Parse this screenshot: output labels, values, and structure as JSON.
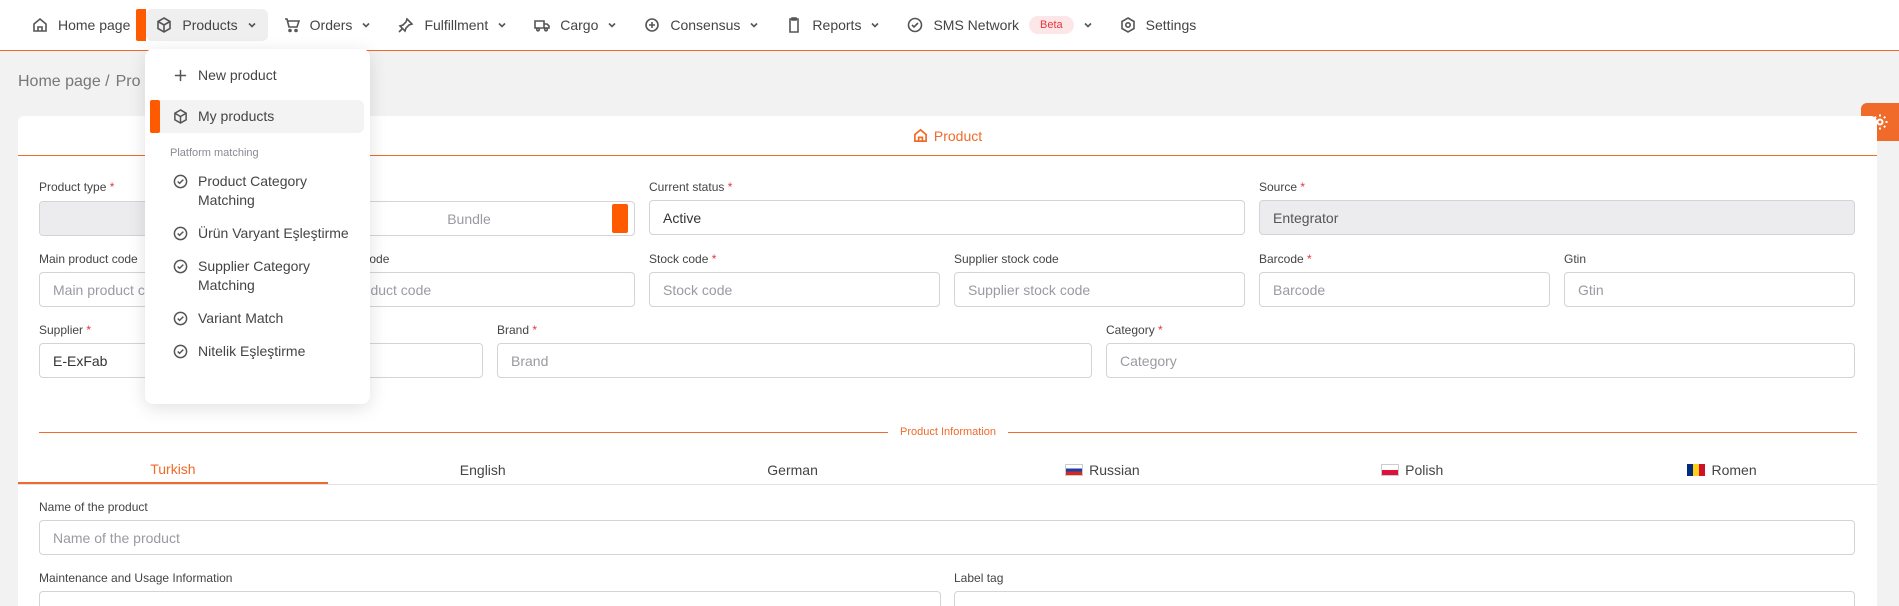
{
  "nav": {
    "items": [
      {
        "label": "Home page",
        "icon": "home-icon"
      },
      {
        "label": "Products",
        "icon": "box-icon"
      },
      {
        "label": "Orders",
        "icon": "cart-icon"
      },
      {
        "label": "Fulfillment",
        "icon": "pin-icon"
      },
      {
        "label": "Cargo",
        "icon": "truck-icon"
      },
      {
        "label": "Consensus",
        "icon": "handshake-icon"
      },
      {
        "label": "Reports",
        "icon": "clipboard-icon"
      },
      {
        "label": "SMS Network",
        "icon": "check-circle-icon",
        "badge": "Beta"
      },
      {
        "label": "Settings",
        "icon": "gear-icon"
      }
    ]
  },
  "breadcrumb": {
    "home": "Home page /",
    "current": "Pro"
  },
  "card": {
    "tab_label": "Product"
  },
  "form": {
    "product_type": {
      "label": "Product type",
      "options": [
        "",
        "Bundle"
      ]
    },
    "current_status": {
      "label": "Current status",
      "value": "Active"
    },
    "source": {
      "label": "Source",
      "value": "Entegrator"
    },
    "main_product_code": {
      "label": "Main product code",
      "placeholder": "Main product c"
    },
    "product_code": {
      "label": "uct code",
      "placeholder": "roduct code"
    },
    "stock_code": {
      "label": "Stock code",
      "placeholder": "Stock code"
    },
    "supplier_stock_code": {
      "label": "Supplier stock code",
      "placeholder": "Supplier stock code"
    },
    "barcode": {
      "label": "Barcode",
      "placeholder": "Barcode"
    },
    "gtin": {
      "label": "Gtin",
      "placeholder": "Gtin"
    },
    "supplier": {
      "label": "Supplier",
      "value": "E-ExFab"
    },
    "brand": {
      "label": "Brand",
      "placeholder": "Brand"
    },
    "category": {
      "label": "Category",
      "placeholder": "Category"
    },
    "required_mark": "*"
  },
  "product_info": {
    "section_title": "Product Information",
    "tabs": [
      "Turkish",
      "English",
      "German",
      "Russian",
      "Polish",
      "Romen"
    ],
    "name_label": "Name of the product",
    "name_placeholder": "Name of the product",
    "maintenance_label": "Maintenance and Usage Information",
    "label_tag_label": "Label tag"
  },
  "dropdown": {
    "items": [
      {
        "label": "New product",
        "icon": "plus-icon"
      },
      {
        "label": "My products",
        "icon": "box-icon"
      }
    ],
    "section_title": "Platform matching",
    "matching": [
      "Product Category Matching",
      "Ürün Varyant Eşleştirme",
      "Supplier Category Matching",
      "Variant Match",
      "Nitelik Eşleştirme"
    ]
  },
  "colors": {
    "accent": "#f06a2a",
    "marker": "#ff5a00",
    "beta_bg": "#fde6e7",
    "beta_text": "#e0383e"
  }
}
